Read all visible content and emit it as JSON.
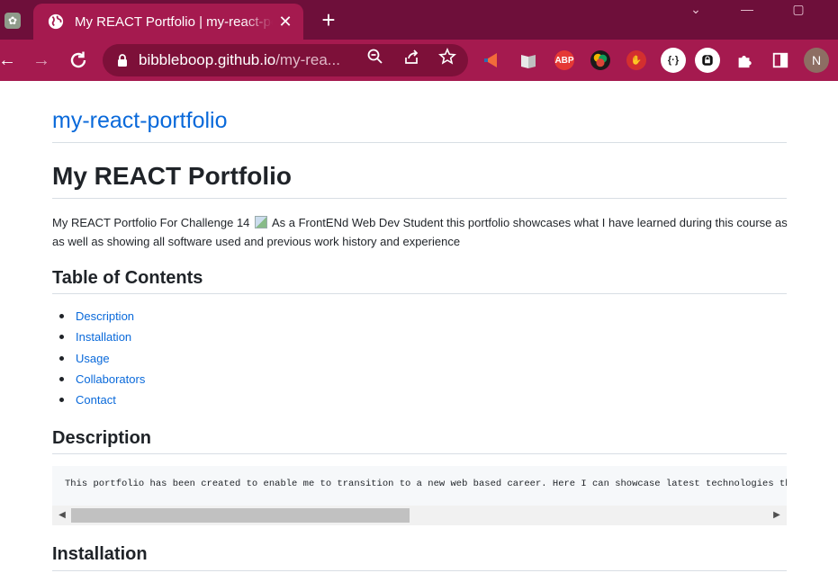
{
  "browser": {
    "tab_title": "My REACT Portfolio | my-react-portfolio",
    "close_glyph": "✕",
    "new_tab_glyph": "+",
    "url_host": "bibbleboop.github.io",
    "url_path": "/my-rea...",
    "window_controls": [
      "⌄",
      "—",
      "▢"
    ],
    "profile_initial": "N",
    "extension_abp_label": "ABP",
    "colors": {
      "tabstrip": "#6e0f3a",
      "toolbar": "#a51a4f",
      "omnibox": "#7d1039"
    }
  },
  "page": {
    "repo_title": "my-react-portfolio",
    "heading": "My REACT Portfolio",
    "intro_line1_before": "My REACT Portfolio For Challenge 14",
    "intro_line1_after": "As a FrontENd Web Dev Student this portfolio showcases what I have learned during this course as",
    "intro_line2": "as well as showing all software used and previous work history and experience",
    "toc_heading": "Table of Contents",
    "toc_items": [
      "Description",
      "Installation",
      "Usage",
      "Collaborators",
      "Contact"
    ],
    "description_heading": "Description",
    "description_code": "This portfolio has been created to enable me to transition to a new web based career. Here I can showcase latest technologies tha",
    "installation_heading": "Installation",
    "scroll_arrow_left": "◀",
    "scroll_arrow_right": "▶"
  }
}
